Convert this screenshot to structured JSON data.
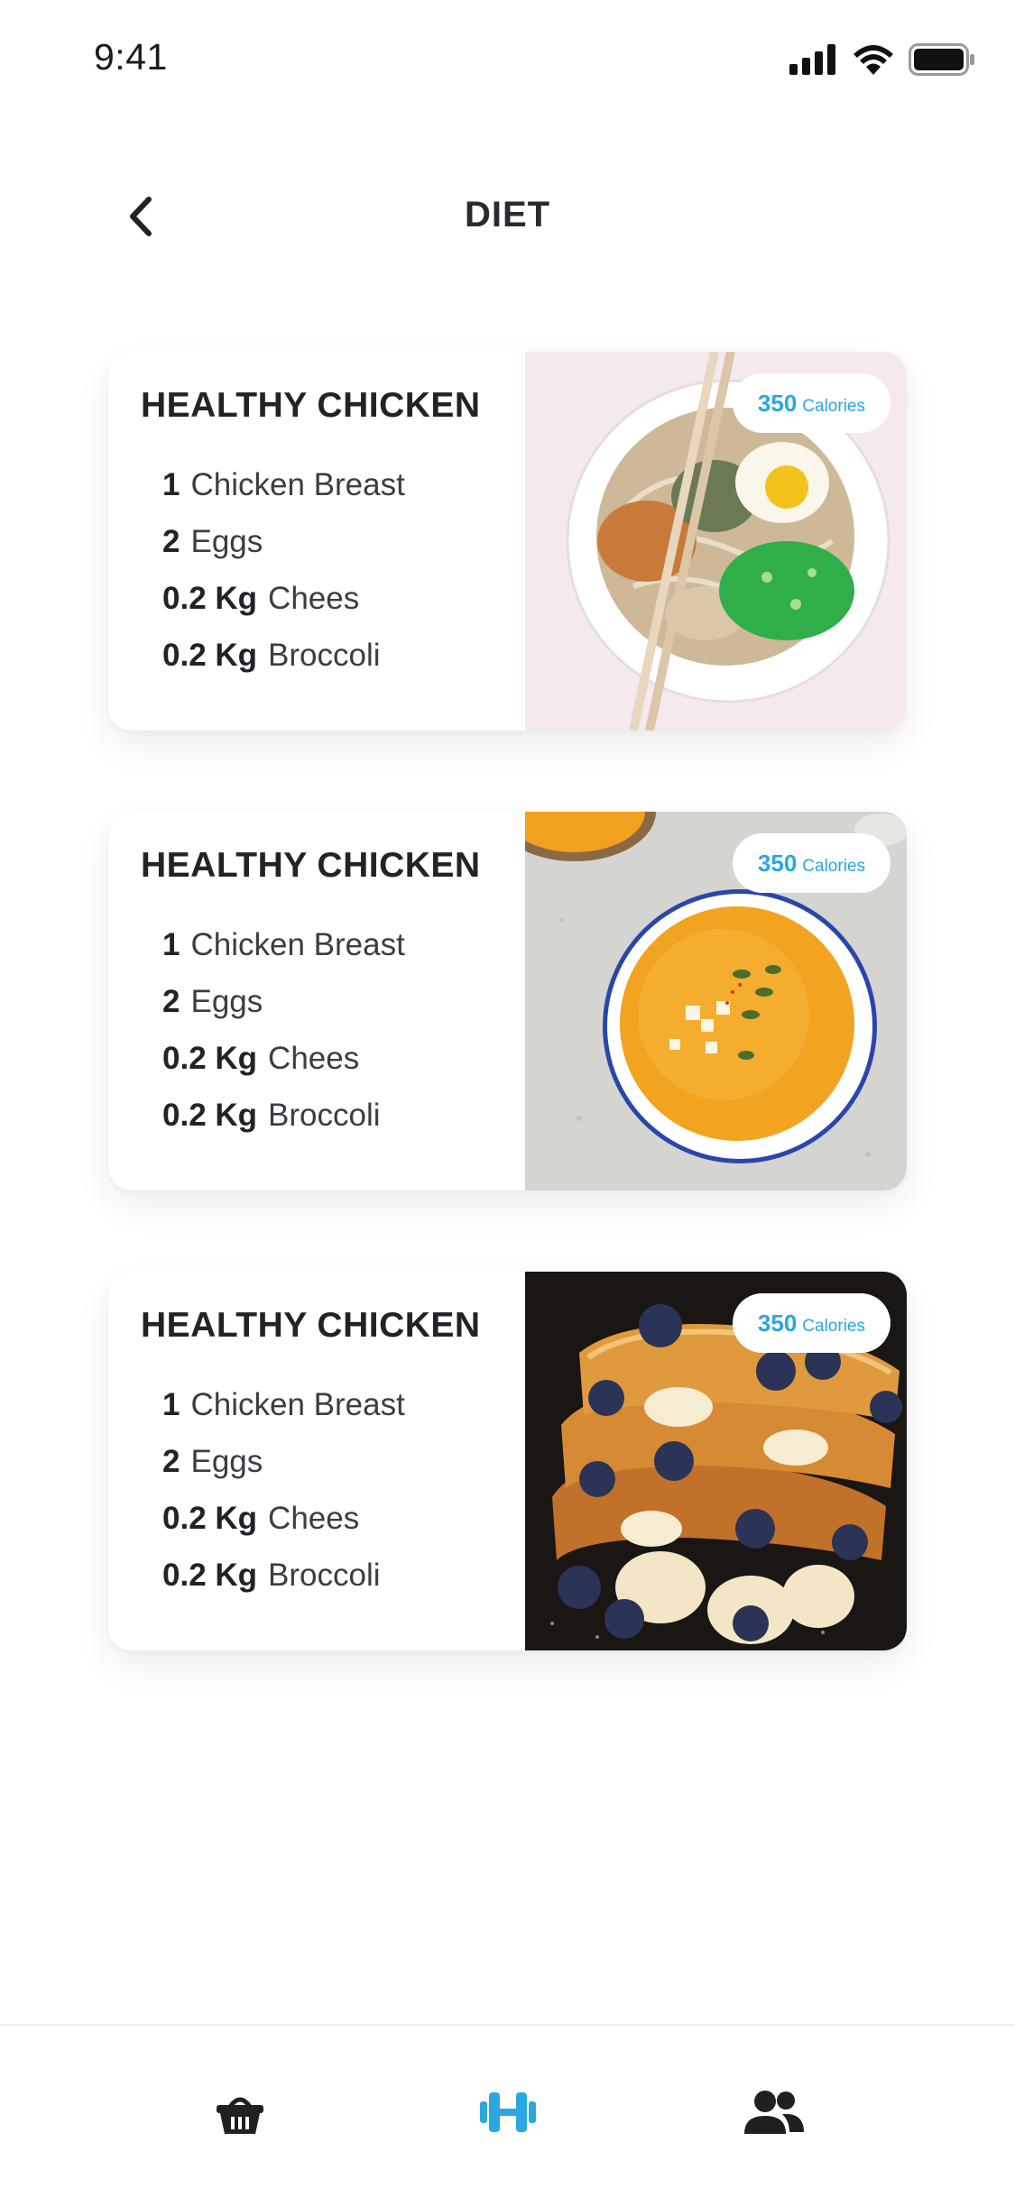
{
  "status_bar": {
    "time": "9:41",
    "icons": [
      "signal-icon",
      "wifi-icon",
      "battery-icon"
    ]
  },
  "header": {
    "title": "DIET",
    "back_icon": "chevron-left-icon"
  },
  "colors": {
    "accent": "#2aa7e0",
    "text_primary": "#222228",
    "text_secondary": "#3c3c44"
  },
  "cards": [
    {
      "title": "HEALTHY CHICKEN",
      "calories_value": "350",
      "calories_unit": "Calories",
      "image": "ramen-bowl-photo",
      "ingredients": [
        {
          "qty": "1",
          "name": "Chicken Breast"
        },
        {
          "qty": "2",
          "name": "Eggs"
        },
        {
          "qty": "0.2 Kg",
          "name": "Chees"
        },
        {
          "qty": "0.2 Kg",
          "name": "Broccoli"
        }
      ]
    },
    {
      "title": "HEALTHY CHICKEN",
      "calories_value": "350",
      "calories_unit": "Calories",
      "image": "pumpkin-soup-photo",
      "ingredients": [
        {
          "qty": "1",
          "name": "Chicken Breast"
        },
        {
          "qty": "2",
          "name": "Eggs"
        },
        {
          "qty": "0.2 Kg",
          "name": "Chees"
        },
        {
          "qty": "0.2 Kg",
          "name": "Broccoli"
        }
      ]
    },
    {
      "title": "HEALTHY CHICKEN",
      "calories_value": "350",
      "calories_unit": "Calories",
      "image": "french-toast-photo",
      "ingredients": [
        {
          "qty": "1",
          "name": "Chicken Breast"
        },
        {
          "qty": "2",
          "name": "Eggs"
        },
        {
          "qty": "0.2 Kg",
          "name": "Chees"
        },
        {
          "qty": "0.2 Kg",
          "name": "Broccoli"
        }
      ]
    }
  ],
  "bottom_nav": {
    "items": [
      {
        "icon": "basket-icon",
        "active": false
      },
      {
        "icon": "dumbbell-icon",
        "active": true
      },
      {
        "icon": "people-icon",
        "active": false
      }
    ]
  }
}
